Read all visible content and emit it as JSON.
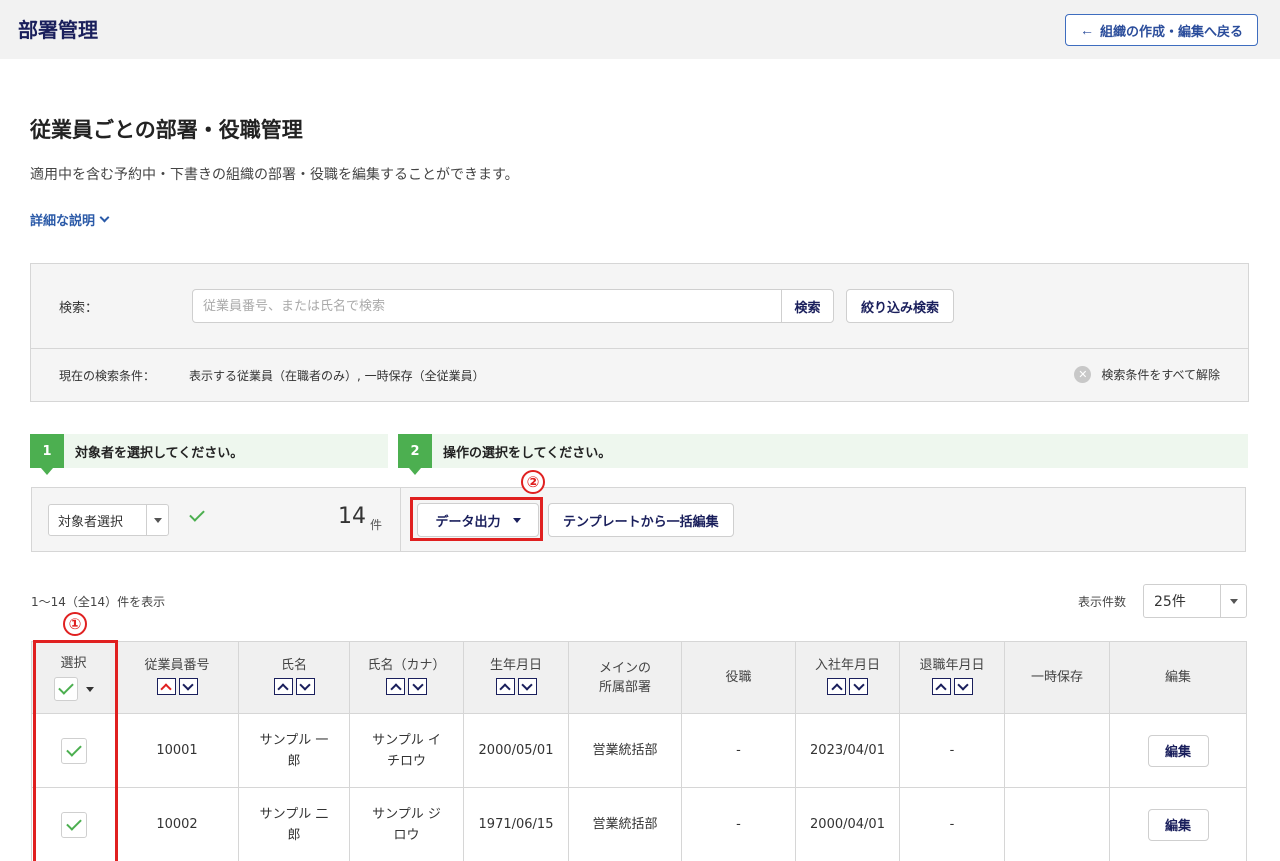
{
  "header": {
    "title": "部署管理",
    "back_label": "組織の作成・編集へ戻る"
  },
  "page": {
    "heading": "従業員ごとの部署・役職管理",
    "description": "適用中を含む予約中・下書きの組織の部署・役職を編集することができます。",
    "detail_link": "詳細な説明"
  },
  "search": {
    "label": "検索：",
    "placeholder": "従業員番号、または氏名で検索",
    "search_button": "検索",
    "filter_button": "絞り込み検索",
    "condition_label": "現在の検索条件：",
    "condition_value": "表示する従業員（在職者のみ）, 一時保存（全従業員）",
    "clear_all": "検索条件をすべて解除"
  },
  "steps": [
    {
      "number": "1",
      "text": "対象者を選択してください。"
    },
    {
      "number": "2",
      "text": "操作の選択をしてください。"
    }
  ],
  "selection": {
    "target_select": "対象者選択",
    "count": "14",
    "count_unit": "件"
  },
  "actions": {
    "export": "データ出力",
    "template_edit": "テンプレートから一括編集"
  },
  "annotations": {
    "marker_1": "①",
    "marker_2": "②"
  },
  "list": {
    "range_text": "1〜14（全14）件を表示",
    "per_page_label": "表示件数",
    "per_page_value": "25件"
  },
  "table": {
    "headers": {
      "select": "選択",
      "emp_no": "従業員番号",
      "name": "氏名",
      "kana": "氏名（カナ）",
      "birth": "生年月日",
      "dept_line1": "メインの",
      "dept_line2": "所属部署",
      "position": "役職",
      "join": "入社年月日",
      "leave": "退職年月日",
      "temp": "一時保存",
      "edit": "編集"
    },
    "rows": [
      {
        "emp_no": "10001",
        "name_line1": "サンプル 一",
        "name_line2": "郎",
        "kana_line1": "サンプル イ",
        "kana_line2": "チロウ",
        "birth": "2000/05/01",
        "dept": "営業統括部",
        "position": "-",
        "join": "2023/04/01",
        "leave": "-",
        "temp": "",
        "edit": "編集"
      },
      {
        "emp_no": "10002",
        "name_line1": "サンプル 二",
        "name_line2": "郎",
        "kana_line1": "サンプル ジ",
        "kana_line2": "ロウ",
        "birth": "1971/06/15",
        "dept": "営業統括部",
        "position": "-",
        "join": "2000/04/01",
        "leave": "-",
        "temp": "",
        "edit": "編集"
      }
    ]
  },
  "colors": {
    "brand_navy": "#1a1f5c",
    "link_blue": "#2b5aa8",
    "step_green": "#4caf50",
    "highlight_red": "#e02020"
  }
}
